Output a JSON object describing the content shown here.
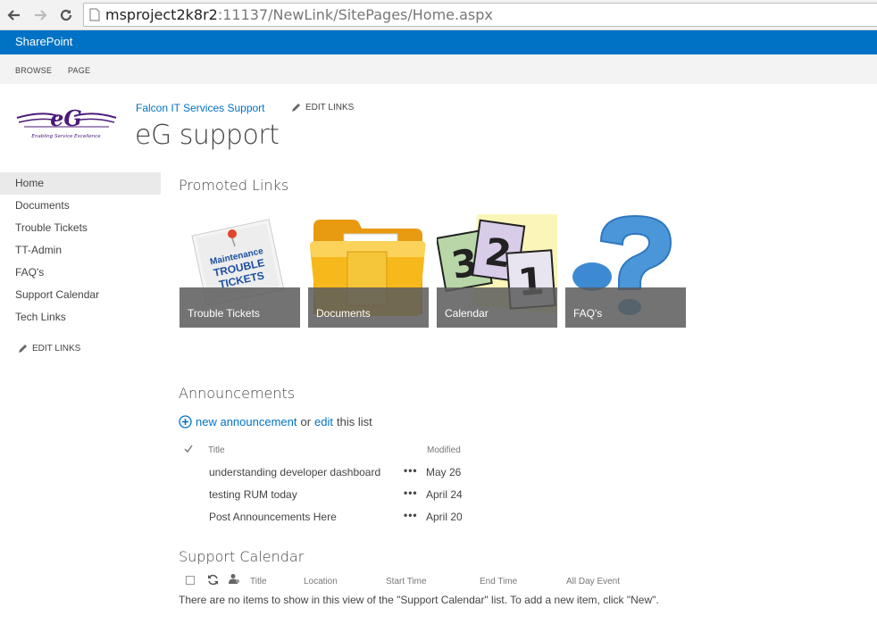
{
  "browser": {
    "url_host": "msproject2k8r2",
    "url_rest": ":11137/NewLink/SitePages/Home.aspx"
  },
  "suite": {
    "brand": "SharePoint"
  },
  "ribbon": {
    "tabs": [
      "BROWSE",
      "PAGE"
    ]
  },
  "header": {
    "logo_text": "eG",
    "logo_tagline": "Enabling Service Excellence",
    "site_link": "Falcon IT Services Support",
    "edit_links": "EDIT LINKS",
    "site_title": "eG support"
  },
  "quick_launch": {
    "items": [
      "Home",
      "Documents",
      "Trouble Tickets",
      "TT-Admin",
      "FAQ's",
      "Support Calendar",
      "Tech Links"
    ],
    "edit_links": "EDIT LINKS"
  },
  "promoted_links": {
    "heading": "Promoted Links",
    "tiles": [
      {
        "label": "Trouble Tickets",
        "sign_line1": "Maintenance",
        "sign_line2": "TROUBLE",
        "sign_line3": "TICKETS"
      },
      {
        "label": "Documents"
      },
      {
        "label": "Calendar"
      },
      {
        "label": "FAQ's"
      }
    ]
  },
  "announcements": {
    "heading": "Announcements",
    "new_link": "new announcement",
    "or_text": "or",
    "edit_link": "edit",
    "this_list": "this list",
    "columns": {
      "title": "Title",
      "modified": "Modified"
    },
    "rows": [
      {
        "title": "understanding developer dashboard",
        "modified": "May 26"
      },
      {
        "title": "testing RUM today",
        "modified": "April 24"
      },
      {
        "title": "Post Announcements Here",
        "modified": "April 20"
      }
    ]
  },
  "support_calendar": {
    "heading": "Support Calendar",
    "columns": [
      "Title",
      "Location",
      "Start Time",
      "End Time",
      "All Day Event"
    ],
    "empty_message": "There are no items to show in this view of the \"Support Calendar\" list. To add a new item, click \"New\"."
  },
  "colors": {
    "accent": "#0072c6",
    "tile_overlay": "#5a5a5a",
    "logo_purple": "#4b1a7a"
  }
}
